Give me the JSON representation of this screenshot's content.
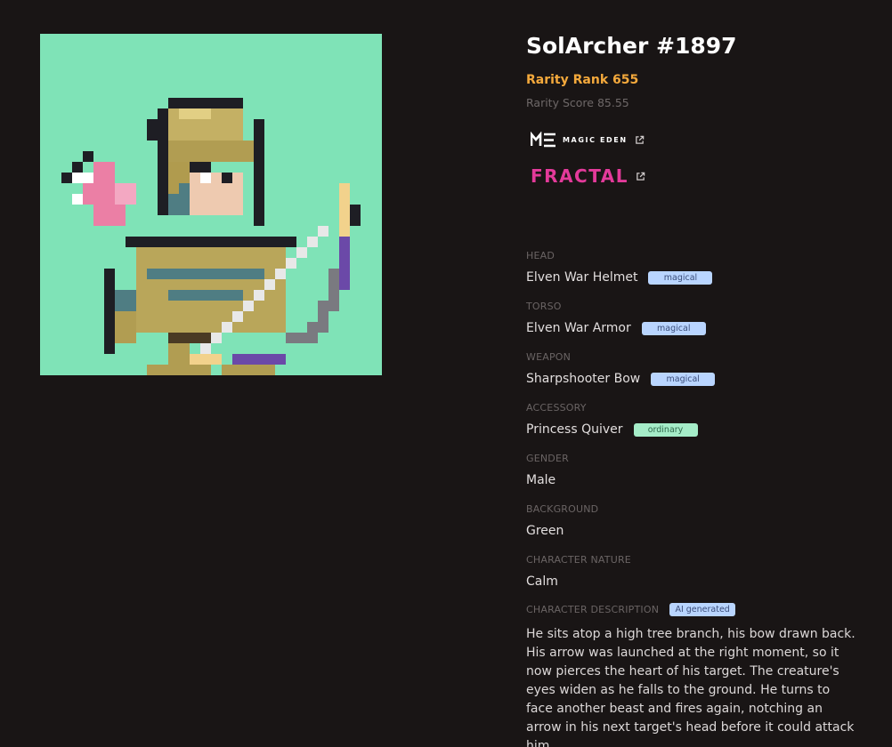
{
  "nft": {
    "title": "SolArcher #1897",
    "rarity_rank": "Rarity Rank 655",
    "rarity_score": "Rarity Score 85.55"
  },
  "marketplaces": {
    "magic_eden": "MAGIC EDEN",
    "fractal": "FRACTAL"
  },
  "attributes": [
    {
      "label": "HEAD",
      "value": "Elven War Helmet",
      "badge": "magical"
    },
    {
      "label": "TORSO",
      "value": "Elven War Armor",
      "badge": "magical"
    },
    {
      "label": "WEAPON",
      "value": "Sharpshooter Bow",
      "badge": "magical"
    },
    {
      "label": "ACCESSORY",
      "value": "Princess Quiver",
      "badge": "ordinary"
    },
    {
      "label": "GENDER",
      "value": "Male"
    },
    {
      "label": "BACKGROUND",
      "value": "Green"
    },
    {
      "label": "CHARACTER NATURE",
      "value": "Calm"
    }
  ],
  "description": {
    "label": "CHARACTER DESCRIPTION",
    "badge": "AI generated",
    "text": "He sits atop a high tree branch, his bow drawn back. His arrow was launched at the right moment, so it now pierces the heart of his target. The creature's eyes widen as he falls to the ground. He turns to face another beast and fires again, notching an arrow in his next target's head before it could attack him."
  },
  "colors": {
    "art_background": "#7fe3b7",
    "rank": "#f4a93c",
    "fractal": "#e33a9a",
    "badge_magical": "#b9d5ff",
    "badge_ordinary": "#a5ecc8"
  }
}
